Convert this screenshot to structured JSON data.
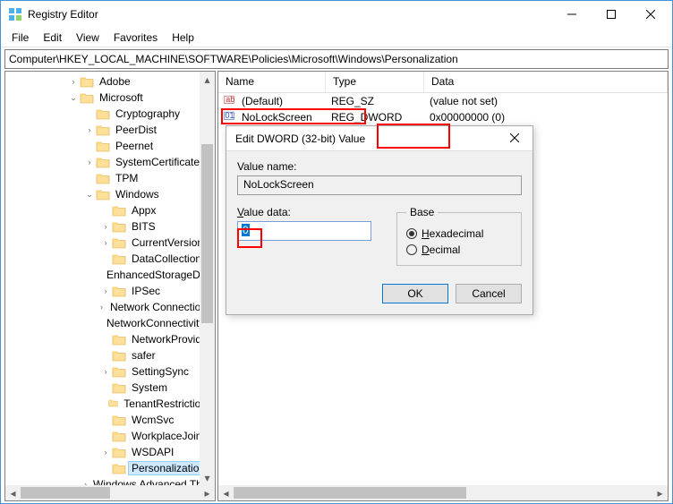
{
  "window": {
    "title": "Registry Editor"
  },
  "menu": {
    "file": "File",
    "edit": "Edit",
    "view": "View",
    "favorites": "Favorites",
    "help": "Help"
  },
  "address_path": "Computer\\HKEY_LOCAL_MACHINE\\SOFTWARE\\Policies\\Microsoft\\Windows\\Personalization",
  "tree": [
    {
      "indent": 70,
      "exp": ">",
      "label": "Adobe"
    },
    {
      "indent": 70,
      "exp": "v",
      "label": "Microsoft"
    },
    {
      "indent": 88,
      "exp": "",
      "label": "Cryptography"
    },
    {
      "indent": 88,
      "exp": ">",
      "label": "PeerDist"
    },
    {
      "indent": 88,
      "exp": "",
      "label": "Peernet"
    },
    {
      "indent": 88,
      "exp": ">",
      "label": "SystemCertificates"
    },
    {
      "indent": 88,
      "exp": "",
      "label": "TPM"
    },
    {
      "indent": 88,
      "exp": "v",
      "label": "Windows"
    },
    {
      "indent": 106,
      "exp": "",
      "label": "Appx"
    },
    {
      "indent": 106,
      "exp": ">",
      "label": "BITS"
    },
    {
      "indent": 106,
      "exp": ">",
      "label": "CurrentVersion"
    },
    {
      "indent": 106,
      "exp": "",
      "label": "DataCollection"
    },
    {
      "indent": 106,
      "exp": "",
      "label": "EnhancedStorageDevices"
    },
    {
      "indent": 106,
      "exp": ">",
      "label": "IPSec"
    },
    {
      "indent": 106,
      "exp": ">",
      "label": "Network Connections"
    },
    {
      "indent": 106,
      "exp": "",
      "label": "NetworkConnectivityStatusIndicator"
    },
    {
      "indent": 106,
      "exp": "",
      "label": "NetworkProvider"
    },
    {
      "indent": 106,
      "exp": "",
      "label": "safer"
    },
    {
      "indent": 106,
      "exp": ">",
      "label": "SettingSync"
    },
    {
      "indent": 106,
      "exp": "",
      "label": "System"
    },
    {
      "indent": 106,
      "exp": "",
      "label": "TenantRestrictions"
    },
    {
      "indent": 106,
      "exp": "",
      "label": "WcmSvc"
    },
    {
      "indent": 106,
      "exp": "",
      "label": "WorkplaceJoin"
    },
    {
      "indent": 106,
      "exp": ">",
      "label": "WSDAPI"
    },
    {
      "indent": 106,
      "exp": "",
      "label": "Personalization",
      "selected": true
    },
    {
      "indent": 88,
      "exp": ">",
      "label": "Windows Advanced Threat Protection"
    }
  ],
  "list": {
    "cols": {
      "name": "Name",
      "type": "Type",
      "data": "Data"
    },
    "rows": [
      {
        "name": "(Default)",
        "type": "REG_SZ",
        "data": "(value not set)",
        "iconKind": "sz"
      },
      {
        "name": "NoLockScreen",
        "type": "REG_DWORD",
        "data": "0x00000000 (0)",
        "iconKind": "dword"
      }
    ]
  },
  "dialog": {
    "title": "Edit DWORD (32-bit) Value",
    "valueNameLabel": "Value name:",
    "valueName": "NoLockScreen",
    "valueDataLabel": "Value data:",
    "valueData": "0",
    "baseLabel": "Base",
    "hex": "Hexadecimal",
    "dec": "Decimal",
    "ok": "OK",
    "cancel": "Cancel"
  }
}
